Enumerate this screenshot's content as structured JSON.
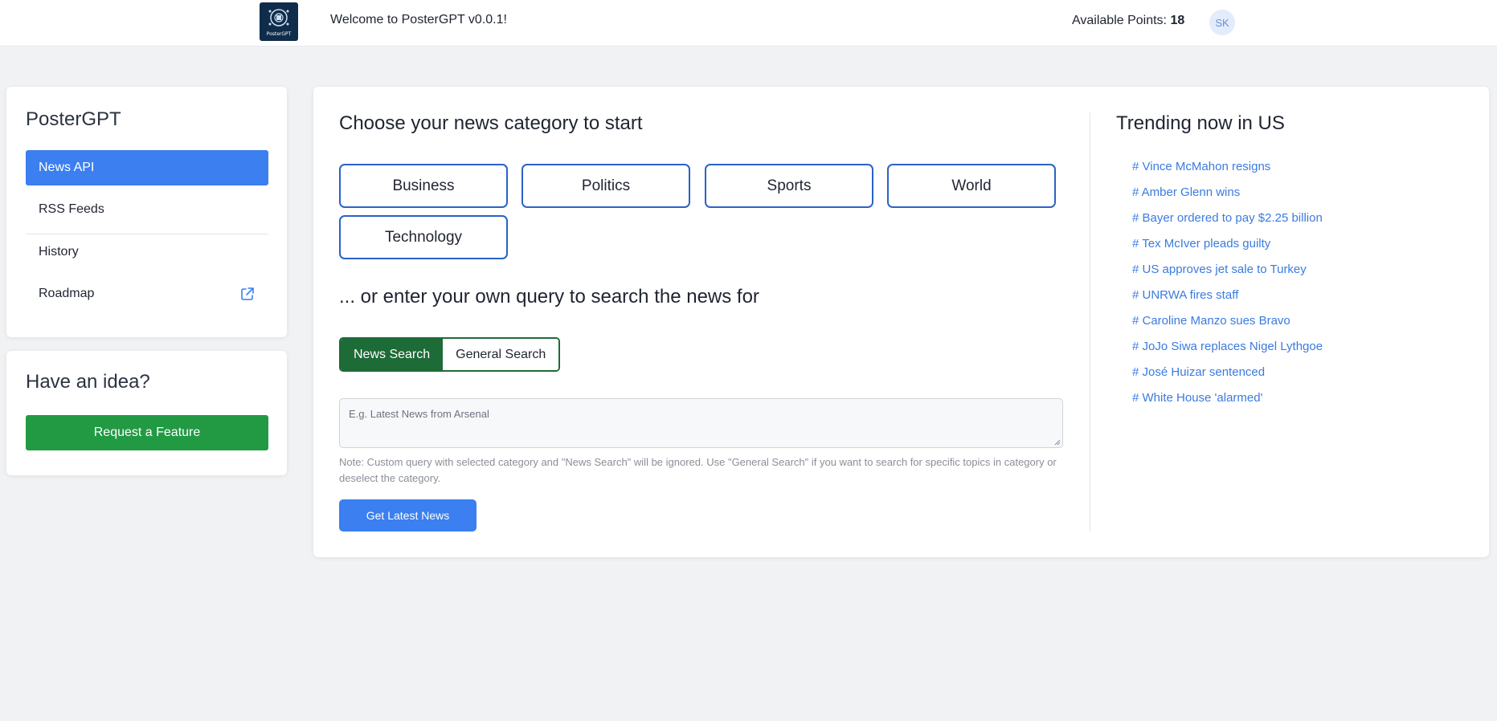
{
  "header": {
    "logo_text": "PosterGPT",
    "welcome": "Welcome to PosterGPT v0.0.1!",
    "points_label": "Available Points:",
    "points_value": "18",
    "avatar_initials": "SK"
  },
  "sidebar": {
    "title": "PosterGPT",
    "items": [
      {
        "label": "News API",
        "active": true
      },
      {
        "label": "RSS Feeds",
        "active": false
      },
      {
        "label": "History",
        "active": false
      },
      {
        "label": "Roadmap",
        "active": false,
        "icon": "external-link-icon"
      }
    ]
  },
  "idea": {
    "title": "Have an idea?",
    "button_label": "Request a Feature"
  },
  "main": {
    "category_heading": "Choose your news category to start",
    "categories": [
      "Business",
      "Politics",
      "Sports",
      "World",
      "Technology"
    ],
    "query_heading": "... or enter your own query to search the news for",
    "search_modes": [
      {
        "label": "News Search",
        "active": true
      },
      {
        "label": "General Search",
        "active": false
      }
    ],
    "query_placeholder": "E.g. Latest News from Arsenal",
    "query_value": "",
    "note": "Note: Custom query with selected category and \"News Search\" will be ignored. Use \"General Search\" if you want to search for specific topics in category or deselect the category.",
    "submit_label": "Get Latest News"
  },
  "trending": {
    "title": "Trending now in US",
    "items": [
      "# Vince McMahon resigns",
      "# Amber Glenn wins",
      "# Bayer ordered to pay $2.25 billion",
      "# Tex McIver pleads guilty",
      "# US approves jet sale to Turkey",
      "# UNRWA fires staff",
      "# Caroline Manzo sues Bravo",
      "# JoJo Siwa replaces Nigel Lythgoe",
      "# José Huizar sentenced",
      "# White House 'alarmed'"
    ]
  },
  "colors": {
    "primary": "#3b7ff0",
    "success": "#229a44",
    "toggle_green": "#1d6b37",
    "category_border": "#2a62c7",
    "link": "#3a7be0",
    "background": "#f1f2f4"
  }
}
